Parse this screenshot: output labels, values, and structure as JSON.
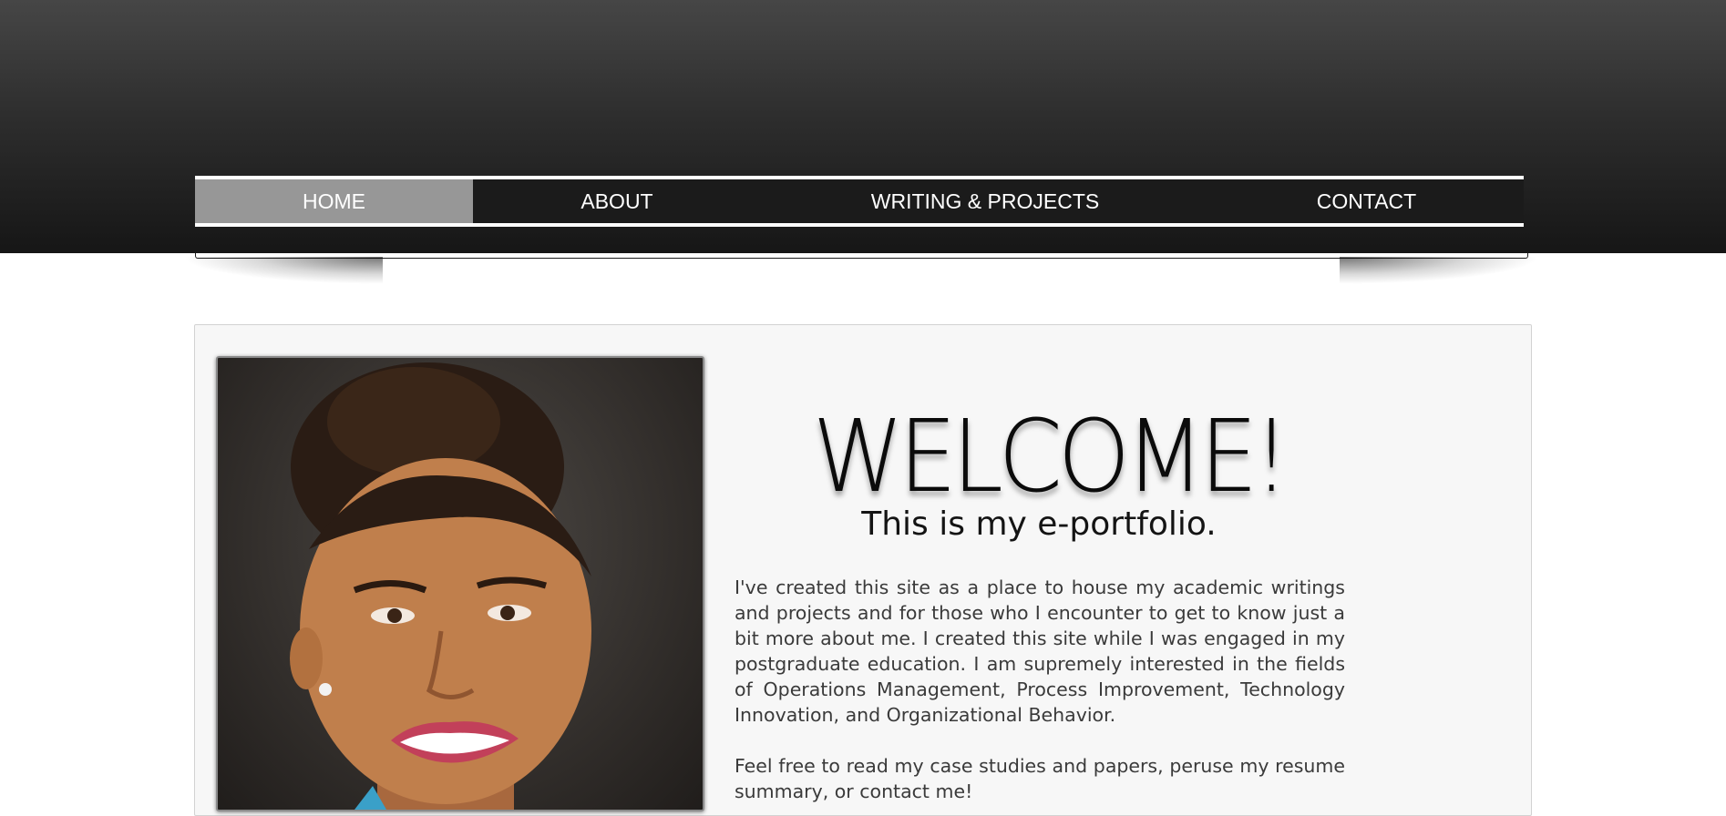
{
  "nav": {
    "items": [
      {
        "label": "HOME",
        "active": true
      },
      {
        "label": "ABOUT",
        "active": false
      },
      {
        "label": "WRITING & PROJECTS",
        "active": false
      },
      {
        "label": "CONTACT",
        "active": false
      }
    ]
  },
  "main": {
    "heading": "WELCOME!",
    "subheading": "This is my e-portfolio.",
    "paragraphs": [
      "I've created this site as a place to house my academic writings and projects and for those who I encounter to get to know just a bit more about me. I created this site while I was engaged in my postgraduate education. I am supremely interested in the fields of Operations Management, Process Improvement, Technology Innovation, and Organizational Behavior.",
      "Feel free to read my case studies and papers, peruse my resume summary, or contact me!"
    ]
  },
  "colors": {
    "header_dark": "#161616",
    "nav_active": "#979797",
    "content_bg": "#f7f7f7"
  }
}
